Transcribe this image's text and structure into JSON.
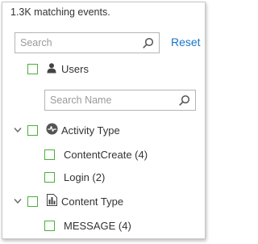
{
  "summary": {
    "text": "1.3K matching events."
  },
  "search": {
    "placeholder": "Search",
    "value": ""
  },
  "reset_label": "Reset",
  "filters": {
    "users": {
      "label": "Users",
      "icon": "user-icon",
      "search_placeholder": "Search Name",
      "search_value": ""
    },
    "activity_type": {
      "label": "Activity Type",
      "icon": "activity-icon",
      "expanded": true,
      "options": [
        {
          "label": "ContentCreate (4)",
          "checked": false
        },
        {
          "label": "Login (2)",
          "checked": false
        }
      ]
    },
    "content_type": {
      "label": "Content Type",
      "icon": "content-type-icon",
      "expanded": true,
      "options": [
        {
          "label": "MESSAGE (4)",
          "checked": false
        }
      ]
    }
  },
  "colors": {
    "checkbox_border": "#4caf3c",
    "link": "#1a75c9",
    "text": "#333333"
  }
}
